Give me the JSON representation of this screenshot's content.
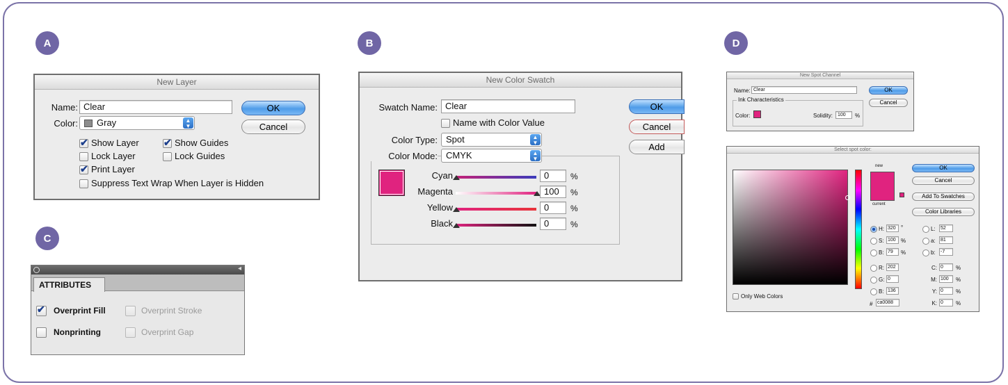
{
  "badges": {
    "a": "A",
    "b": "B",
    "c": "C",
    "d": "D"
  },
  "colors": {
    "accent": "#7066a5",
    "spot": "#e0237f",
    "swatch_pink": "#ca0088"
  },
  "panel_a": {
    "title": "New Layer",
    "name_label": "Name:",
    "name_value": "Clear",
    "color_label": "Color:",
    "color_value": "Gray",
    "ok": "OK",
    "cancel": "Cancel",
    "checks": {
      "show_layer": {
        "label": "Show Layer",
        "checked": true
      },
      "show_guides": {
        "label": "Show Guides",
        "checked": true
      },
      "lock_layer": {
        "label": "Lock Layer",
        "checked": false
      },
      "lock_guides": {
        "label": "Lock Guides",
        "checked": false
      },
      "print_layer": {
        "label": "Print Layer",
        "checked": true
      },
      "suppress": {
        "label": "Suppress Text Wrap When Layer is Hidden",
        "checked": false
      }
    }
  },
  "panel_b": {
    "title": "New Color Swatch",
    "swatch_name_label": "Swatch Name:",
    "swatch_name_value": "Clear",
    "name_with_value": "Name with Color Value",
    "color_type_label": "Color Type:",
    "color_type_value": "Spot",
    "color_mode_label": "Color Mode:",
    "color_mode_value": "CMYK",
    "ok": "OK",
    "cancel": "Cancel",
    "add": "Add",
    "pct": "%",
    "sliders": [
      {
        "label": "Cyan",
        "value": "0"
      },
      {
        "label": "Magenta",
        "value": "100"
      },
      {
        "label": "Yellow",
        "value": "0"
      },
      {
        "label": "Black",
        "value": "0"
      }
    ]
  },
  "panel_c": {
    "tab": "ATTRIBUTES",
    "overprint_fill": "Overprint Fill",
    "overprint_stroke": "Overprint Stroke",
    "nonprinting": "Nonprinting",
    "overprint_gap": "Overprint Gap"
  },
  "panel_d": {
    "spot": {
      "title": "New Spot Channel",
      "name_label": "Name:",
      "name_value": "Clear",
      "ink_group": "Ink Characteristics",
      "color_label": "Color:",
      "solidity_label": "Solidity:",
      "solidity_value": "100",
      "pct": "%",
      "ok": "OK",
      "cancel": "Cancel"
    },
    "picker": {
      "title": "Select spot color:",
      "new_label": "new",
      "current_label": "current",
      "ok": "OK",
      "cancel": "Cancel",
      "add_to_swatches": "Add To Swatches",
      "color_libraries": "Color Libraries",
      "only_web": "Only Web Colors",
      "h_label": "H:",
      "h_value": "320",
      "deg": "°",
      "s_label": "S:",
      "s_value": "100",
      "b_label": "B:",
      "b_value": "79",
      "r_label": "R:",
      "r_value": "202",
      "g_label": "G:",
      "g_value": "0",
      "b2_label": "B:",
      "b2_value": "136",
      "l_label": "L:",
      "l_value": "52",
      "a_label": "a:",
      "a_value": "81",
      "bb_label": "b:",
      "bb_value": "-7",
      "c_label": "C:",
      "c_value": "0",
      "m_label": "M:",
      "m_value": "100",
      "y_label": "Y:",
      "y_value": "0",
      "k_label": "K:",
      "k_value": "0",
      "pct": "%",
      "hash": "#",
      "hex_value": "ca0088"
    }
  }
}
